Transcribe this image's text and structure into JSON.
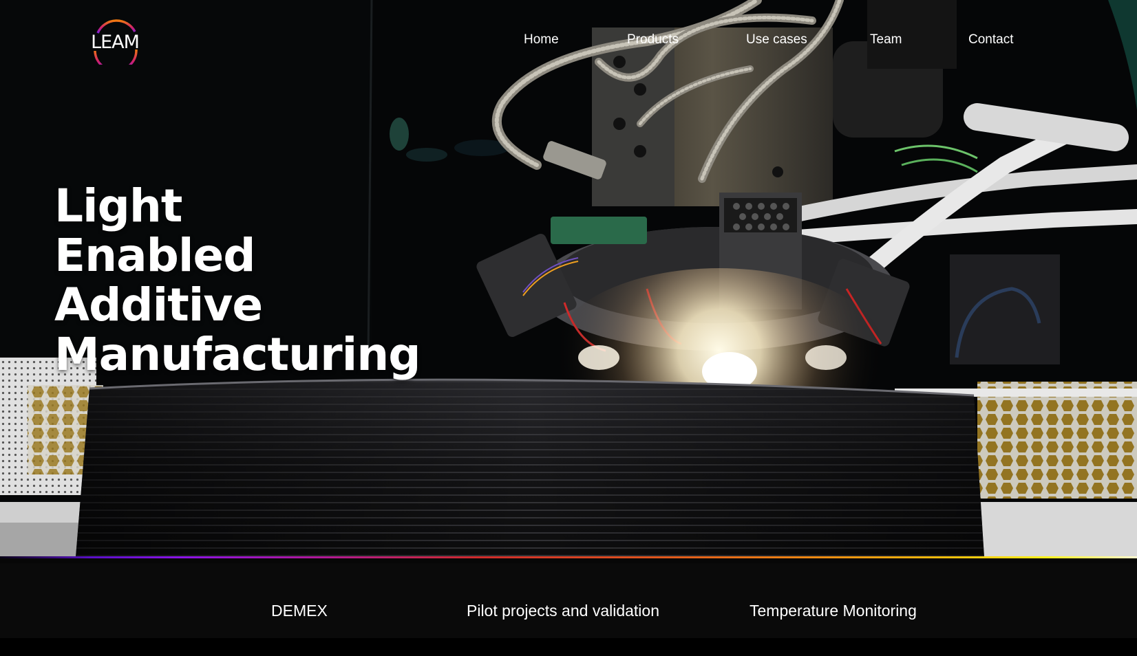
{
  "brand": {
    "logo_text": "LEAM"
  },
  "nav": {
    "items": [
      {
        "label": "Home"
      },
      {
        "label": "Products"
      },
      {
        "label": "Use cases"
      },
      {
        "label": "Team"
      },
      {
        "label": "Contact"
      }
    ]
  },
  "hero": {
    "headline_lines": [
      "Light",
      "Enabled",
      "Additive",
      "Manufacturing"
    ]
  },
  "products": {
    "items": [
      {
        "label": "DEMEX"
      },
      {
        "label": "Pilot projects and validation"
      },
      {
        "label": "Temperature Monitoring"
      }
    ]
  },
  "colors": {
    "background": "#070707",
    "text": "#ffffff",
    "gradient": [
      "#5a10c8",
      "#8b14e8",
      "#d02a2a",
      "#ef8a12",
      "#fff21a"
    ],
    "logo_ring": [
      "#f07a10",
      "#d0206a",
      "#7a20e0"
    ]
  }
}
